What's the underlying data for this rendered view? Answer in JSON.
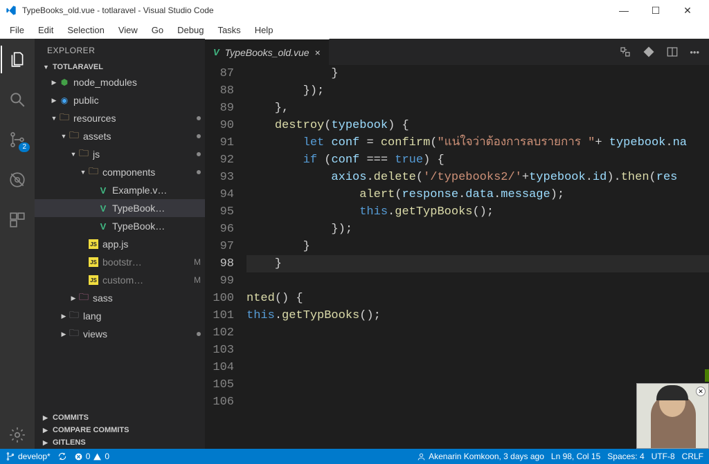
{
  "window": {
    "title": "TypeBooks_old.vue - totlaravel - Visual Studio Code"
  },
  "menu": [
    "File",
    "Edit",
    "Selection",
    "View",
    "Go",
    "Debug",
    "Tasks",
    "Help"
  ],
  "activity": {
    "scm_badge": "2"
  },
  "sidebar": {
    "title": "EXPLORER",
    "project": "TOTLARAVEL",
    "tree": [
      {
        "indent": 1,
        "arrow": "▶",
        "icon": "green-mod",
        "label": "node_modules"
      },
      {
        "indent": 1,
        "arrow": "▶",
        "icon": "blue-mod",
        "label": "public"
      },
      {
        "indent": 1,
        "arrow": "▼",
        "icon": "folder",
        "label": "resources",
        "dot": true
      },
      {
        "indent": 2,
        "arrow": "▼",
        "icon": "folder",
        "label": "assets",
        "dot": true
      },
      {
        "indent": 3,
        "arrow": "▼",
        "icon": "folder",
        "label": "js",
        "dot": true
      },
      {
        "indent": 4,
        "arrow": "▼",
        "icon": "folder",
        "label": "components",
        "dot": true
      },
      {
        "indent": 5,
        "arrow": "",
        "icon": "vue",
        "label": "Example.v…"
      },
      {
        "indent": 5,
        "arrow": "",
        "icon": "vue",
        "label": "TypeBook…",
        "active": true
      },
      {
        "indent": 5,
        "arrow": "",
        "icon": "vue",
        "label": "TypeBook…"
      },
      {
        "indent": 4,
        "arrow": "",
        "icon": "js",
        "label": "app.js"
      },
      {
        "indent": 4,
        "arrow": "",
        "icon": "js",
        "label": "bootstr…",
        "tag": "M",
        "dim": true
      },
      {
        "indent": 4,
        "arrow": "",
        "icon": "js",
        "label": "custom…",
        "tag": "M",
        "dim": true
      },
      {
        "indent": 3,
        "arrow": "▶",
        "icon": "pink",
        "label": "sass"
      },
      {
        "indent": 2,
        "arrow": "▶",
        "icon": "grey",
        "label": "lang"
      },
      {
        "indent": 2,
        "arrow": "▶",
        "icon": "grey",
        "label": "views",
        "dot": true
      }
    ],
    "sections": [
      "COMMITS",
      "COMPARE COMMITS",
      "GITLENS"
    ]
  },
  "editor": {
    "tab_label": "TypeBooks_old.vue",
    "first_line_no": 87,
    "current_line": 98,
    "lines": [
      "            }",
      "        });",
      "    },",
      "    destroy(typebook) {",
      "        let conf = confirm(\"แน่ใจว่าต้องการลบรายการ \"+ typebook.na",
      "        if (conf === true) {",
      "            axios.delete('/typebooks2/'+typebook.id).then(res",
      "                alert(response.data.message);",
      "                this.getTypBooks();",
      "            });",
      "        }",
      "    }",
      "",
      "nted() {",
      "this.getTypBooks();",
      "",
      "",
      "",
      "",
      ""
    ]
  },
  "status": {
    "branch": "develop*",
    "errors": "0",
    "warnings": "0",
    "blame": "Akenarin Komkoon, 3 days ago",
    "position": "Ln 98, Col 15",
    "spaces": "Spaces: 4",
    "encoding": "UTF-8",
    "eol": "CRLF"
  }
}
